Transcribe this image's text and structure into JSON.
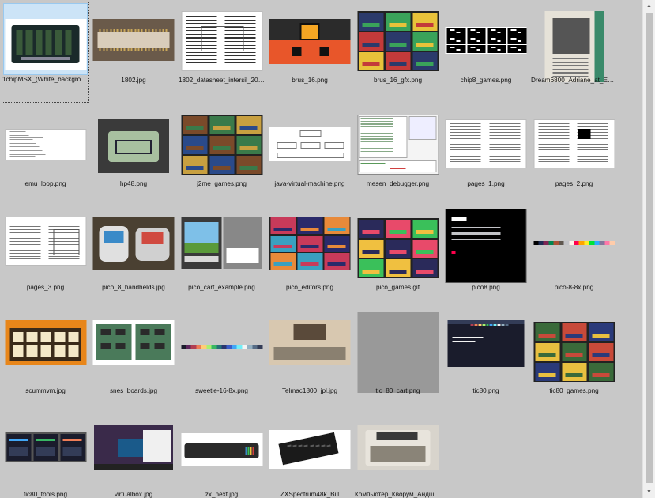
{
  "view": {
    "selected_index": 0
  },
  "scrollbar": {
    "up_glyph": "▲",
    "down_glyph": "▼"
  },
  "items": [
    {
      "name": "1chipMSX_(White_background).jpg",
      "icon": "pcb-photo-icon",
      "type": "pcb",
      "colors": [
        "#ffffff",
        "#1a2a2a",
        "#3a5a3a"
      ]
    },
    {
      "name": "1802.jpg",
      "icon": "chip-photo-icon",
      "type": "chip",
      "colors": [
        "#6a5a4a",
        "#d9cdbb",
        "#caa85a"
      ]
    },
    {
      "name": "1802_datasheet_intersil_2008....",
      "icon": "datasheet-icon",
      "type": "doc",
      "colors": [
        "#ffffff",
        "#333333"
      ]
    },
    {
      "name": "brus_16.png",
      "icon": "console-screen-icon",
      "type": "brus",
      "colors": [
        "#2b2b2b",
        "#e8562a",
        "#f5a623"
      ]
    },
    {
      "name": "brus_16_gfx.png",
      "icon": "game-grid-icon",
      "type": "grid",
      "colors": [
        "#2b3a6b",
        "#3aa35a",
        "#e8c23a",
        "#c33a3a"
      ]
    },
    {
      "name": "chip8_games.png",
      "icon": "chip8-games-icon",
      "type": "bw",
      "colors": [
        "#000000",
        "#ffffff"
      ]
    },
    {
      "name": "Dream6800_Adriane_at_EA_1...",
      "icon": "magazine-photo-icon",
      "type": "mag",
      "colors": [
        "#e6e2d8",
        "#555555",
        "#3a8a6a"
      ]
    },
    {
      "name": "emu_loop.png",
      "icon": "code-doc-icon",
      "type": "code",
      "colors": [
        "#ffffff",
        "#999999"
      ]
    },
    {
      "name": "hp48.png",
      "icon": "calculator-icon",
      "type": "hp",
      "colors": [
        "#3a3a3a",
        "#a8c0a0",
        "#1a1a1a"
      ]
    },
    {
      "name": "j2me_games.png",
      "icon": "game-grid-icon",
      "type": "grid",
      "colors": [
        "#7a4a2a",
        "#3a7a4a",
        "#c8a040",
        "#2a4a8a"
      ]
    },
    {
      "name": "java-virtual-machine.png",
      "icon": "diagram-icon",
      "type": "diagram",
      "colors": [
        "#ffffff",
        "#888888"
      ]
    },
    {
      "name": "mesen_debugger.png",
      "icon": "debugger-window-icon",
      "type": "mesen",
      "colors": [
        "#f4f4f4",
        "#5a9a5a",
        "#d04040"
      ]
    },
    {
      "name": "pages_1.png",
      "icon": "paper-page-icon",
      "type": "paper",
      "colors": [
        "#ffffff",
        "#777777"
      ]
    },
    {
      "name": "pages_2.png",
      "icon": "paper-page-icon",
      "type": "paper2",
      "colors": [
        "#ffffff",
        "#777777",
        "#000000"
      ]
    },
    {
      "name": "pages_3.png",
      "icon": "paper-page-icon",
      "type": "paper3",
      "colors": [
        "#ffffff",
        "#777777"
      ]
    },
    {
      "name": "pico_8_handhelds.jpg",
      "icon": "handheld-photo-icon",
      "type": "handheld",
      "colors": [
        "#4a4032",
        "#e0e0e0",
        "#3a8ac8",
        "#d04a40"
      ]
    },
    {
      "name": "pico_cart_example.png",
      "icon": "cart-icon",
      "type": "cart",
      "colors": [
        "#3a3a3a",
        "#7ec0e8",
        "#5a9a3a",
        "#d8d8d8"
      ]
    },
    {
      "name": "pico_editors.png",
      "icon": "game-grid-icon",
      "type": "editors",
      "colors": [
        "#c83a5a",
        "#2a2a6a",
        "#e88a3a",
        "#3aa0c0"
      ]
    },
    {
      "name": "pico_games.gif",
      "icon": "game-grid-icon",
      "type": "grid",
      "colors": [
        "#2a2a5a",
        "#e84a6a",
        "#3ac05a",
        "#f0c040"
      ]
    },
    {
      "name": "pico8.png",
      "icon": "terminal-icon",
      "type": "pico8",
      "colors": [
        "#000000",
        "#ffffff",
        "#ff004d"
      ]
    },
    {
      "name": "pico-8-8x.png",
      "icon": "palette-strip-icon",
      "type": "palette",
      "colors": [
        "#000000",
        "#1d2b53",
        "#7e2553",
        "#008751",
        "#ab5236",
        "#5f574f",
        "#c2c3c7",
        "#fff1e8",
        "#ff004d",
        "#ffa300",
        "#ffec27",
        "#00e436",
        "#29adff",
        "#83769c",
        "#ff77a8",
        "#ffccaa"
      ]
    },
    {
      "name": "scummvm.jpg",
      "icon": "launcher-icon",
      "type": "scumm",
      "colors": [
        "#e8861a",
        "#3a2a1a",
        "#f4e8c8"
      ]
    },
    {
      "name": "snes_boards.jpg",
      "icon": "pcb-photo-icon",
      "type": "snes",
      "colors": [
        "#ffffff",
        "#4a7a5a",
        "#2a2a2a"
      ]
    },
    {
      "name": "sweetie-16-8x.png",
      "icon": "palette-strip-icon",
      "type": "palette",
      "colors": [
        "#1a1c2c",
        "#5d275d",
        "#b13e53",
        "#ef7d57",
        "#ffcd75",
        "#a7f070",
        "#38b764",
        "#257179",
        "#29366f",
        "#3b5dc9",
        "#41a6f6",
        "#73eff7",
        "#f4f4f4",
        "#94b0c2",
        "#566c86",
        "#333c57"
      ]
    },
    {
      "name": "Telmac1800_jpl.jpg",
      "icon": "computer-photo-icon",
      "type": "telmac",
      "colors": [
        "#d8c8b0",
        "#5a4a3a",
        "#8a8070"
      ]
    },
    {
      "name": "tic_80_cart.png",
      "icon": "cart-icon",
      "type": "tic",
      "colors": [
        "#1a1c2c",
        "#333c57",
        "#94b0c2",
        "#f4f4f4"
      ]
    },
    {
      "name": "tic80.png",
      "icon": "terminal-icon",
      "type": "tic80",
      "colors": [
        "#1a1c2c",
        "#f4f4f4",
        "#41a6f6"
      ]
    },
    {
      "name": "tic80_games.png",
      "icon": "game-grid-icon",
      "type": "grid",
      "colors": [
        "#3a6a3a",
        "#c84a3a",
        "#2a3a7a",
        "#e8c040"
      ]
    },
    {
      "name": "tic80_tools.png",
      "icon": "editor-tools-icon",
      "type": "tools",
      "colors": [
        "#1a1c2c",
        "#41a6f6",
        "#38b764",
        "#ef7d57"
      ]
    },
    {
      "name": "virtualbox.jpg",
      "icon": "desktop-screenshot-icon",
      "type": "vbox",
      "colors": [
        "#3a2a4a",
        "#1a5a8a",
        "#f0f0f0"
      ]
    },
    {
      "name": "zx_next.jpg",
      "icon": "keyboard-photo-icon",
      "type": "zxnext",
      "colors": [
        "#ffffff",
        "#2a2a2a",
        "#d04040"
      ]
    },
    {
      "name": "ZXSpectrum48k_Bill",
      "icon": "keyboard-photo-icon",
      "type": "zx48",
      "colors": [
        "#ffffff",
        "#1a1a1a",
        "#5a5a5a"
      ]
    },
    {
      "name": "Компьютер_Кворум_Андше...",
      "icon": "computer-photo-icon",
      "type": "kvorum",
      "colors": [
        "#d8d4cc",
        "#8a8478",
        "#3a3a3a"
      ]
    }
  ]
}
